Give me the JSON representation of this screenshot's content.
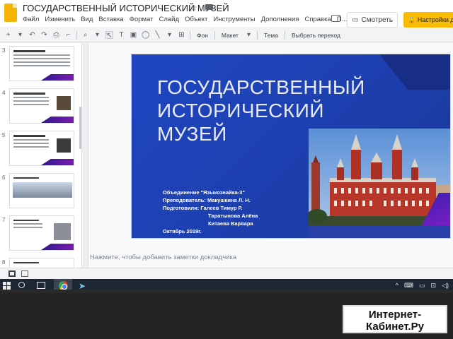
{
  "app": {
    "title": "ГОСУДАРСТВЕННЫЙ ИСТОРИЧЕСКИЙ МУЗЕЙ",
    "menu": [
      "Файл",
      "Изменить",
      "Вид",
      "Вставка",
      "Формат",
      "Слайд",
      "Объект",
      "Инструменты",
      "Дополнения",
      "Справка",
      "П..."
    ],
    "share_label": "Смотреть",
    "settings_label": "Настройки до"
  },
  "toolbar": {
    "background_label": "Фон",
    "layout_label": "Макет",
    "theme_label": "Тема",
    "transition_label": "Выбрать переход"
  },
  "filmstrip": {
    "slides": [
      {
        "number": "3"
      },
      {
        "number": "4"
      },
      {
        "number": "5"
      },
      {
        "number": "6"
      },
      {
        "number": "7"
      },
      {
        "number": "8"
      }
    ]
  },
  "slide": {
    "title_lines": [
      "ГОСУДАРСТВЕННЫЙ",
      "ИСТОРИЧЕСКИЙ",
      "МУЗЕЙ"
    ],
    "info": {
      "line1": "Объединение \"Языкознайка-3\"",
      "line2": "Преподователь: Макушкина Л. Н.",
      "line3": "Подготовили:    Галеев Тимур Р.",
      "line4": "Таратынова Алёна",
      "line5": "Китаева Варвара",
      "line6": "Октябрь 2019г."
    }
  },
  "notes": {
    "placeholder": "Нажмите, чтобы добавить заметки докладчика"
  },
  "taskbar": {
    "tray": [
      "^",
      "⌨",
      "▭",
      "⊡",
      "◁)"
    ]
  },
  "watermark": {
    "line1": "Интернет-",
    "line2": "Кабинет.Ру"
  },
  "colors": {
    "slide_blue": "#1f44b8",
    "accent_yellow": "#fbbc04",
    "accent_purple": "#7a1ec4"
  }
}
